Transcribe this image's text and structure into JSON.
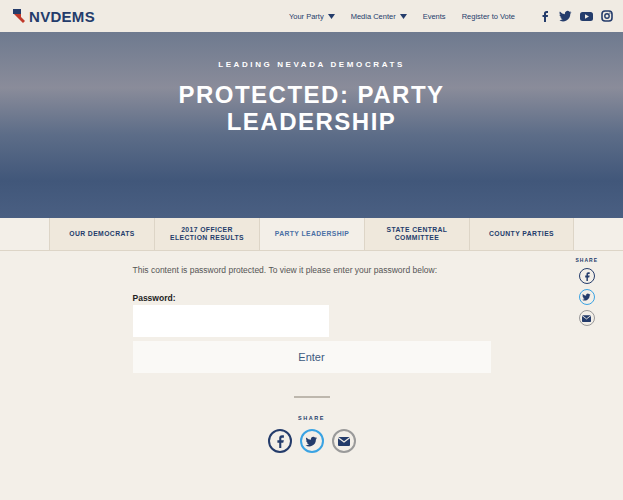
{
  "logo": {
    "text": "NVDEMS"
  },
  "nav": [
    {
      "label": "Your Party",
      "dropdown": true
    },
    {
      "label": "Media Center",
      "dropdown": true
    },
    {
      "label": "Events",
      "dropdown": false
    },
    {
      "label": "Register to Vote",
      "dropdown": false
    }
  ],
  "hero": {
    "kicker": "LEADING NEVADA DEMOCRATS",
    "title": "PROTECTED: PARTY LEADERSHIP"
  },
  "tabs": [
    {
      "label": "OUR DEMOCRATS",
      "selected": false
    },
    {
      "label": "2017 OFFICER ELECTION RESULTS",
      "selected": false
    },
    {
      "label": "PARTY LEADERSHIP",
      "selected": true
    },
    {
      "label": "STATE CENTRAL COMMITTEE",
      "selected": false
    },
    {
      "label": "COUNTY PARTIES",
      "selected": false
    }
  ],
  "content": {
    "notice": "This content is password protected. To view it please enter your password below:",
    "password_label": "Password:",
    "password_value": "",
    "button": "Enter"
  },
  "side_share": {
    "label": "SHARE"
  },
  "bottom_share": {
    "label": "SHARE"
  }
}
